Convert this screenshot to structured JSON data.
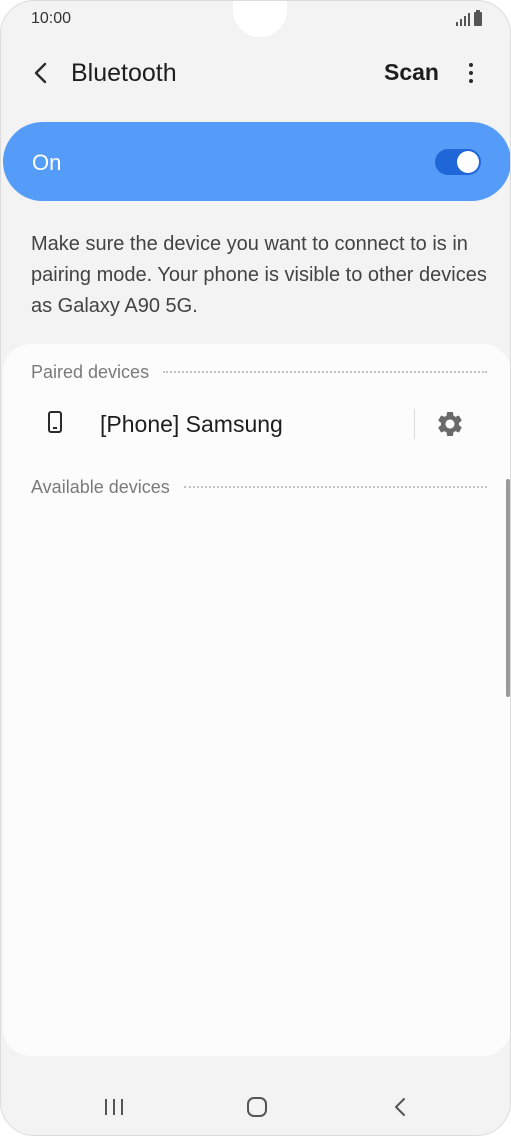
{
  "status_bar": {
    "time": "10:00"
  },
  "header": {
    "title": "Bluetooth",
    "scan_label": "Scan"
  },
  "master_switch": {
    "label": "On",
    "enabled": true,
    "accent": "#559cf9",
    "switch_color": "#1f66d8"
  },
  "info_text": "Make sure the device you want to connect to is in pairing mode. Your phone is visible to other devices as Galaxy A90 5G.",
  "paired": {
    "header": "Paired devices",
    "devices": [
      {
        "name": "[Phone] Samsung",
        "icon": "phone-icon"
      }
    ]
  },
  "available": {
    "header": "Available devices"
  },
  "nav": {
    "recents_icon": "recents-icon",
    "home_icon": "home-icon",
    "back_icon": "back-icon"
  }
}
